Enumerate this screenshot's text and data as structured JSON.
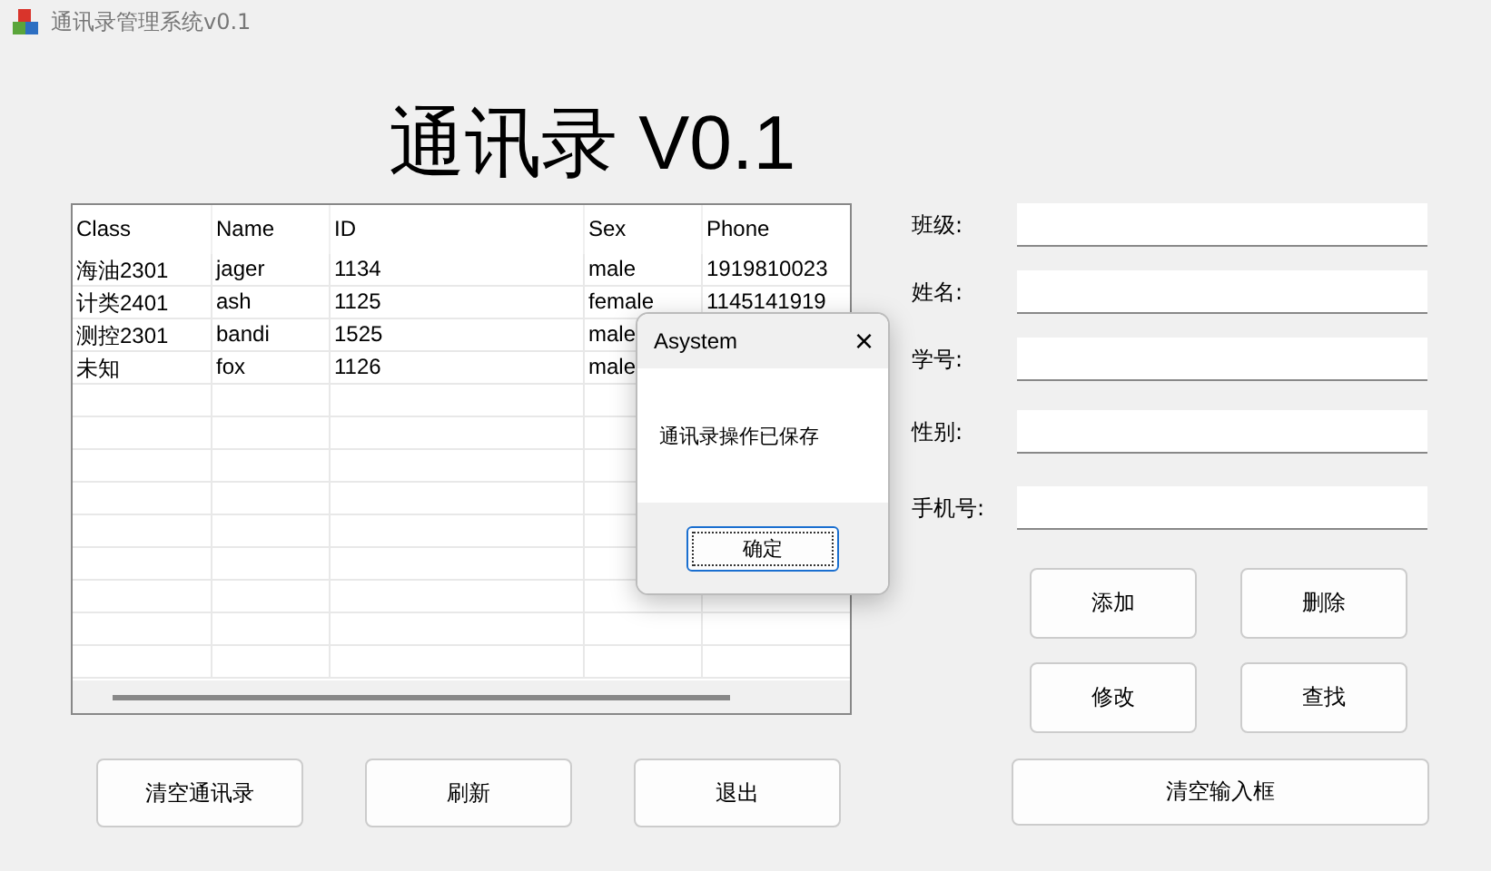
{
  "window": {
    "title": "通讯录管理系统v0.1"
  },
  "heading": "通讯录 V0.1",
  "table": {
    "columns": [
      "Class",
      "Name",
      "ID",
      "Sex",
      "Phone"
    ],
    "rows": [
      [
        "海油2301",
        "jager",
        "1134",
        "male",
        "1919810023"
      ],
      [
        "计类2401",
        "ash",
        "1125",
        "female",
        "1145141919"
      ],
      [
        "测控2301",
        "bandi",
        "1525",
        "male",
        ""
      ],
      [
        "未知",
        "fox",
        "1126",
        "male",
        ""
      ]
    ]
  },
  "bottom_buttons": [
    "清空通讯录",
    "刷新",
    "退出"
  ],
  "form": [
    {
      "label": "班级:"
    },
    {
      "label": "姓名:"
    },
    {
      "label": "学号:"
    },
    {
      "label": "性别:"
    },
    {
      "label": "手机号:"
    }
  ],
  "action_buttons": [
    "添加",
    "删除",
    "修改",
    "查找"
  ],
  "clear_button": "清空输入框",
  "dialog": {
    "title": "Asystem",
    "close": "×",
    "message": "通讯录操作已保存",
    "button": "确定"
  }
}
